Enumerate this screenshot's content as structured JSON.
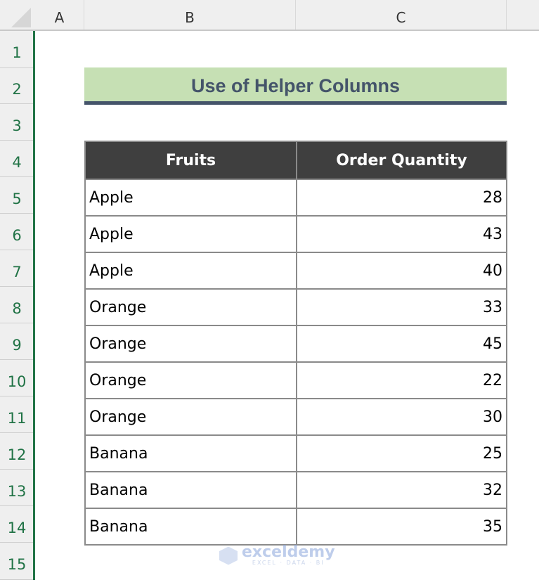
{
  "spreadsheet": {
    "columns": [
      "A",
      "B",
      "C"
    ],
    "rows": [
      "1",
      "2",
      "3",
      "4",
      "5",
      "6",
      "7",
      "8",
      "9",
      "10",
      "11",
      "12",
      "13",
      "14",
      "15"
    ]
  },
  "title": "Use of Helper Columns",
  "table": {
    "headers": [
      "Fruits",
      "Order Quantity"
    ],
    "rows": [
      {
        "fruit": "Apple",
        "qty": "28"
      },
      {
        "fruit": "Apple",
        "qty": "43"
      },
      {
        "fruit": "Apple",
        "qty": "40"
      },
      {
        "fruit": "Orange",
        "qty": "33"
      },
      {
        "fruit": "Orange",
        "qty": "45"
      },
      {
        "fruit": "Orange",
        "qty": "22"
      },
      {
        "fruit": "Orange",
        "qty": "30"
      },
      {
        "fruit": "Banana",
        "qty": "25"
      },
      {
        "fruit": "Banana",
        "qty": "32"
      },
      {
        "fruit": "Banana",
        "qty": "35"
      }
    ]
  },
  "watermark": {
    "name": "exceldemy",
    "tagline": "EXCEL · DATA · BI"
  },
  "colors": {
    "title_fill": "#c6e0b4",
    "title_text": "#44546a",
    "header_fill": "#3f3f3f",
    "row_header_text": "#217346"
  }
}
